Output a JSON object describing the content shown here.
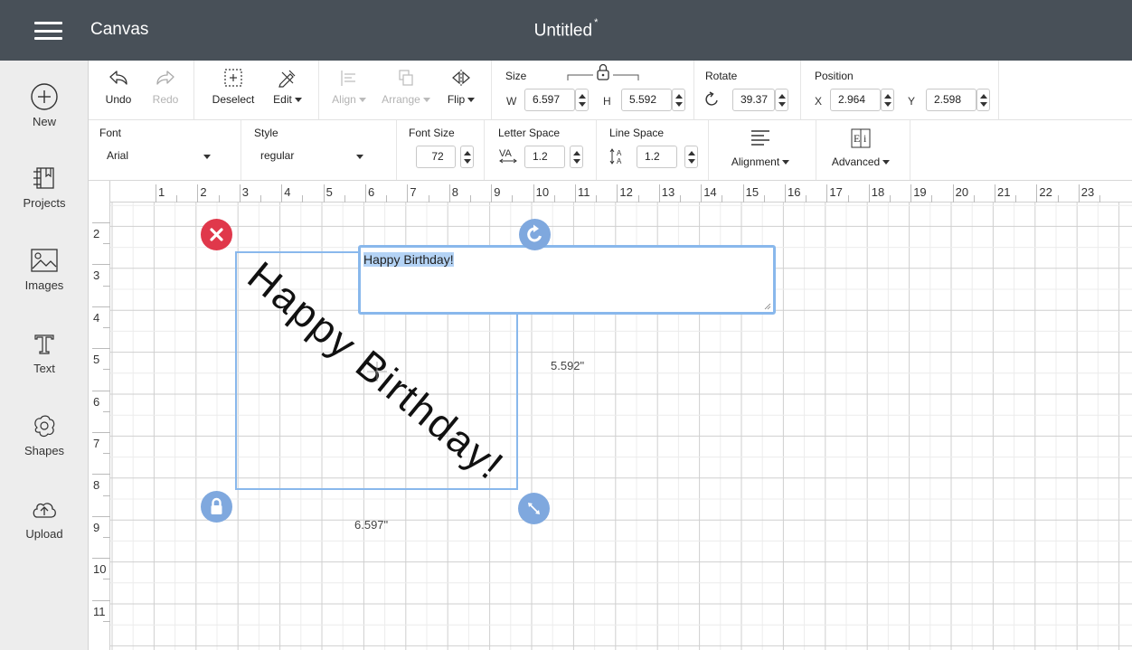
{
  "header": {
    "app_title": "Canvas",
    "doc_title": "Untitled",
    "unsaved_marker": "*"
  },
  "sidebar": {
    "items": [
      {
        "label": "New",
        "icon": "plus-circle-icon"
      },
      {
        "label": "Projects",
        "icon": "projects-icon"
      },
      {
        "label": "Images",
        "icon": "images-icon"
      },
      {
        "label": "Text",
        "icon": "text-icon"
      },
      {
        "label": "Shapes",
        "icon": "shapes-icon"
      },
      {
        "label": "Upload",
        "icon": "cloud-upload-icon"
      }
    ]
  },
  "toolbar": {
    "undo_label": "Undo",
    "redo_label": "Redo",
    "deselect_label": "Deselect",
    "edit_label": "Edit",
    "align_label": "Align",
    "arrange_label": "Arrange",
    "flip_label": "Flip",
    "size": {
      "label": "Size",
      "w_label": "W",
      "w_value": "6.597",
      "h_label": "H",
      "h_value": "5.592"
    },
    "rotate": {
      "label": "Rotate",
      "value": "39.37"
    },
    "position": {
      "label": "Position",
      "x_label": "X",
      "x_value": "2.964",
      "y_label": "Y",
      "y_value": "2.598"
    }
  },
  "text_toolbar": {
    "font": {
      "label": "Font",
      "value": "Arial"
    },
    "style": {
      "label": "Style",
      "value": "regular"
    },
    "font_size": {
      "label": "Font Size",
      "value": "72"
    },
    "letter_space": {
      "label": "Letter Space",
      "value": "1.2"
    },
    "line_space": {
      "label": "Line Space",
      "value": "1.2"
    },
    "alignment_label": "Alignment",
    "advanced_label": "Advanced"
  },
  "ruler": {
    "top": [
      "1",
      "2",
      "3",
      "4",
      "5",
      "6",
      "7",
      "8",
      "9",
      "10",
      "11",
      "12",
      "13",
      "14",
      "15",
      "16",
      "17",
      "18",
      "19",
      "20",
      "21",
      "22",
      "23"
    ],
    "left": [
      "2",
      "3",
      "4",
      "5",
      "6",
      "7",
      "8",
      "9",
      "10",
      "11"
    ]
  },
  "canvas": {
    "width_dim": "6.597\"",
    "height_dim": "5.592\"",
    "text_content": "Happy Birthday!",
    "rotation_deg": 39.37,
    "colors": {
      "delete": "#e0384b",
      "handle": "#7fa8de",
      "selection": "#89b8ec"
    }
  }
}
